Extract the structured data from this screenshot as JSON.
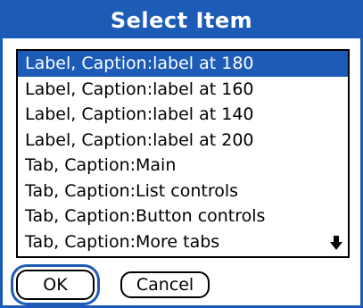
{
  "dialog": {
    "title": "Select Item",
    "accent_color": "#1c5bb6"
  },
  "list": {
    "items": [
      {
        "label": "Label, Caption:label at 180",
        "selected": true
      },
      {
        "label": "Label, Caption:label at 160",
        "selected": false
      },
      {
        "label": "Label, Caption:label at 140",
        "selected": false
      },
      {
        "label": "Label, Caption:label at 200",
        "selected": false
      },
      {
        "label": "Tab, Caption:Main",
        "selected": false
      },
      {
        "label": "Tab, Caption:List controls",
        "selected": false
      },
      {
        "label": "Tab, Caption:Button controls",
        "selected": false
      },
      {
        "label": "Tab, Caption:More tabs",
        "selected": false
      }
    ],
    "scroll_indicator_icon": "arrow-down-icon"
  },
  "buttons": {
    "ok_label": "OK",
    "cancel_label": "Cancel"
  }
}
